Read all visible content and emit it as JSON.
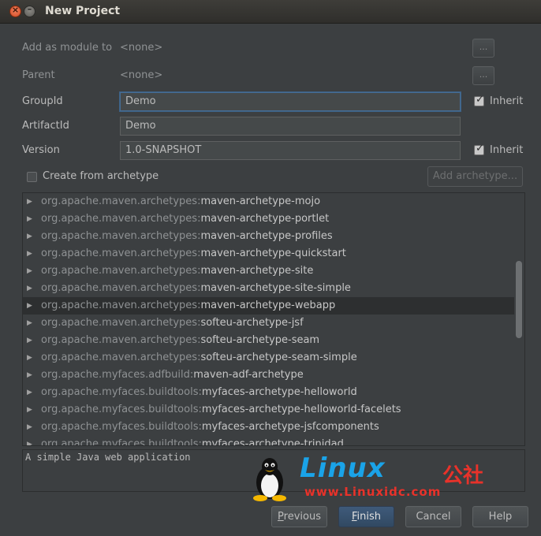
{
  "window": {
    "title": "New Project"
  },
  "form": {
    "module_label": "Add as module to",
    "module_value": "<none>",
    "parent_label": "Parent",
    "parent_value": "<none>",
    "browse_label": "...",
    "groupid_label": "GroupId",
    "groupid_value": "Demo",
    "artifactid_label": "ArtifactId",
    "artifactid_value": "Demo",
    "version_label": "Version",
    "version_value": "1.0-SNAPSHOT",
    "inherit_label": "Inherit",
    "groupid_inherit": true,
    "version_inherit": true
  },
  "archetype": {
    "create_label": "Create from archetype",
    "create_checked": false,
    "add_button": "Add archetype..."
  },
  "tree": {
    "items": [
      {
        "group": "org.apache.maven.archetypes:",
        "artifact": "maven-archetype-mojo"
      },
      {
        "group": "org.apache.maven.archetypes:",
        "artifact": "maven-archetype-portlet"
      },
      {
        "group": "org.apache.maven.archetypes:",
        "artifact": "maven-archetype-profiles"
      },
      {
        "group": "org.apache.maven.archetypes:",
        "artifact": "maven-archetype-quickstart"
      },
      {
        "group": "org.apache.maven.archetypes:",
        "artifact": "maven-archetype-site"
      },
      {
        "group": "org.apache.maven.archetypes:",
        "artifact": "maven-archetype-site-simple"
      },
      {
        "group": "org.apache.maven.archetypes:",
        "artifact": "maven-archetype-webapp"
      },
      {
        "group": "org.apache.maven.archetypes:",
        "artifact": "softeu-archetype-jsf"
      },
      {
        "group": "org.apache.maven.archetypes:",
        "artifact": "softeu-archetype-seam"
      },
      {
        "group": "org.apache.maven.archetypes:",
        "artifact": "softeu-archetype-seam-simple"
      },
      {
        "group": "org.apache.myfaces.adfbuild:",
        "artifact": "maven-adf-archetype"
      },
      {
        "group": "org.apache.myfaces.buildtools:",
        "artifact": "myfaces-archetype-helloworld"
      },
      {
        "group": "org.apache.myfaces.buildtools:",
        "artifact": "myfaces-archetype-helloworld-facelets"
      },
      {
        "group": "org.apache.myfaces.buildtools:",
        "artifact": "myfaces-archetype-jsfcomponents"
      },
      {
        "group": "org.apache.myfaces.buildtools:",
        "artifact": "myfaces-archetype-trinidad"
      }
    ],
    "selected_index": 6
  },
  "description": "A simple Java web application",
  "buttons": {
    "previous": "Previous",
    "finish": "Finish",
    "cancel": "Cancel",
    "help": "Help"
  },
  "watermark": {
    "brand": "Linux",
    "cjk": "公社",
    "url": "www.Linuxidc.com"
  },
  "colors": {
    "background": "#3c3f41",
    "selection": "#2d2f30",
    "accent_blue": "#1aa3e8",
    "accent_red": "#e8322a"
  }
}
